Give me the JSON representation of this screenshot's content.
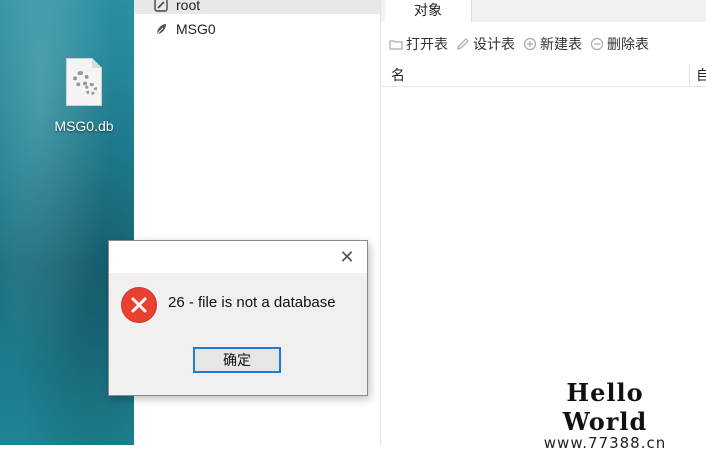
{
  "desktop": {
    "file_icon": {
      "name": "gear-file-icon",
      "label": "MSG0.db"
    }
  },
  "tree": {
    "items": [
      {
        "label": "root",
        "icon": "connection-icon",
        "selected": true
      },
      {
        "label": "MSG0",
        "icon": "database-icon",
        "selected": false
      }
    ]
  },
  "objects": {
    "tab_label": "对象",
    "toolbar": {
      "open_label": "打开表",
      "design_label": "设计表",
      "new_label": "新建表",
      "delete_label": "删除表"
    },
    "columns": [
      "名",
      "自"
    ]
  },
  "dialog": {
    "icon": "error-icon",
    "message": "26 - file is not a database",
    "ok_label": "确定",
    "close_glyph": "✕"
  },
  "watermark": {
    "title": "Hello World",
    "url": "www.77388.cn"
  },
  "colors": {
    "accent": "#1f7ad1",
    "error": "#e8412f",
    "desktop": "#1e7f92"
  }
}
